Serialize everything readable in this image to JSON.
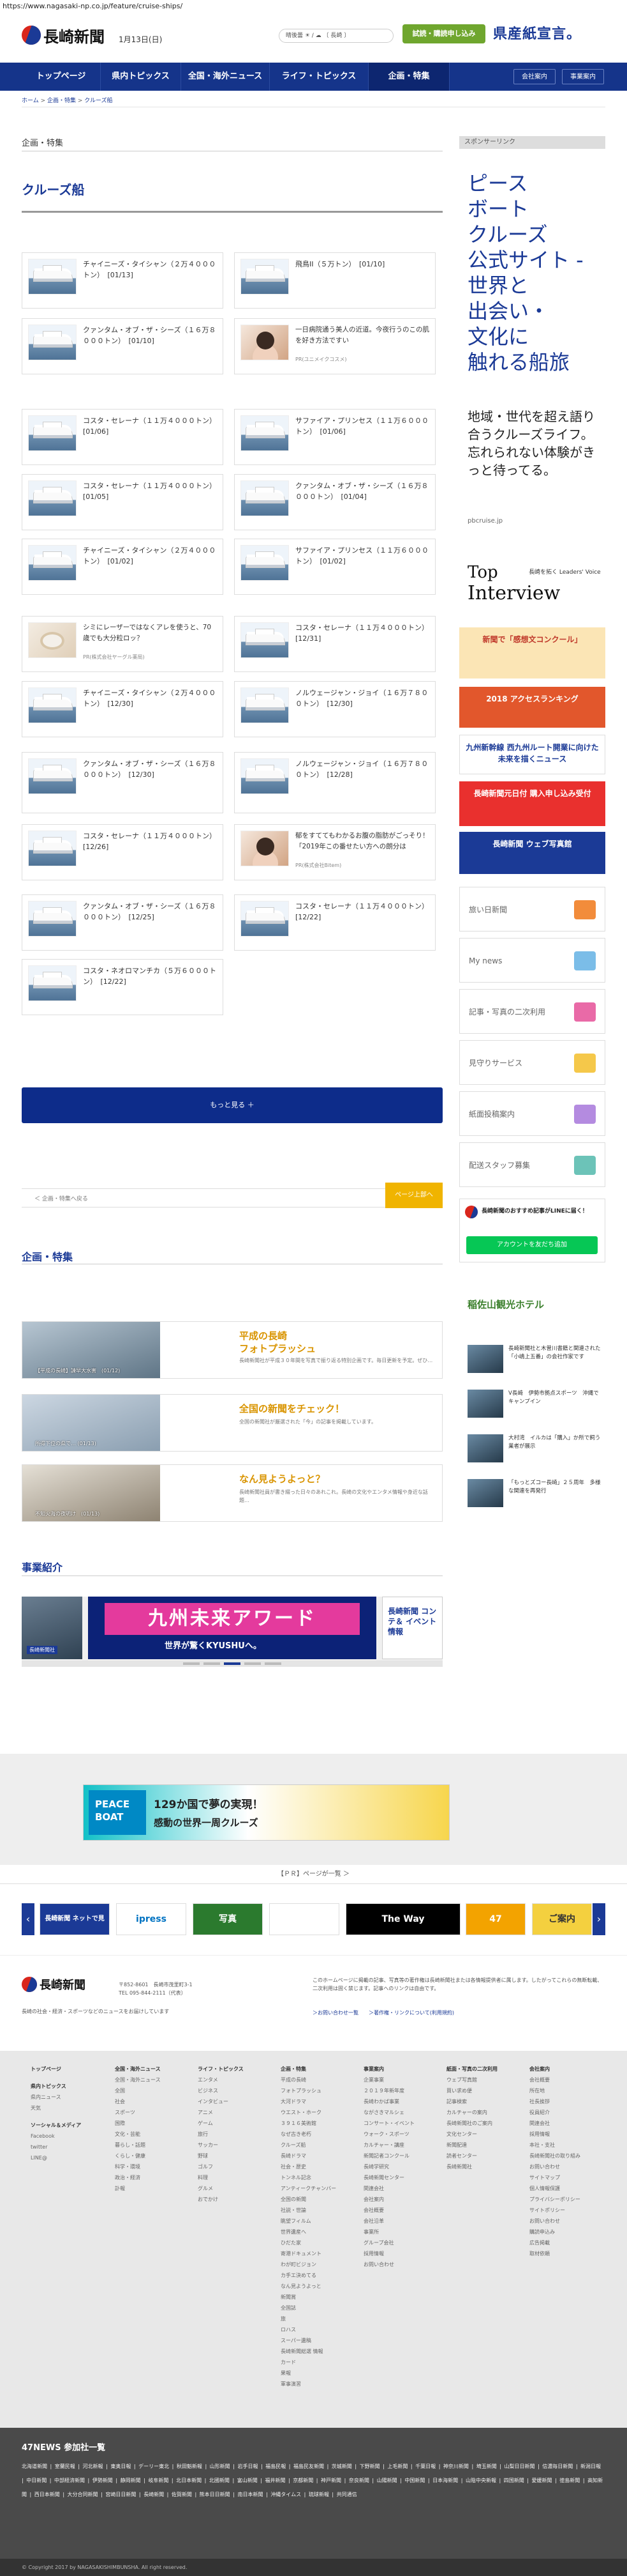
{
  "url": "https://www.nagasaki-np.co.jp/feature/cruise-ships/",
  "header": {
    "logo": "長崎新聞",
    "date": "1月13日(日)",
    "weather": "晴後曇 ☀ / ☁ 〔 長崎 〕",
    "trial_button": "試読・購読申し込み",
    "banner_text": "県産紙宣言。",
    "banner_accent": "紙"
  },
  "nav": {
    "items": [
      "トップページ",
      "県内トピックス",
      "全国・海外ニュース",
      "ライフ・トピックス",
      "企画・特集"
    ],
    "active_index": 4,
    "right": [
      "会社案内",
      "事業案内"
    ]
  },
  "breadcrumb": {
    "items": [
      "ホーム",
      "企画・特集",
      "クルーズ船"
    ],
    "separator": " > "
  },
  "section_label": "企画・特集",
  "page_title": "クルーズ船",
  "cards": [
    {
      "kind": "ship",
      "text": "チャイニーズ・タイシャン（２万４０００トン）　[01/13]"
    },
    {
      "kind": "ship",
      "text": "飛鳥II（５万トン）　[01/10]"
    },
    {
      "kind": "ship",
      "text": "クァンタム・オブ・ザ・シーズ（１６万８０００トン）　[01/10]"
    },
    {
      "kind": "person",
      "text": "一日病院通う美人の近道。今夜行うのこの肌を好き方法ですい",
      "sub": "PR(ユニメイクコスメ)"
    },
    {
      "kind": "ship",
      "text": "コスタ・セレーナ（１１万４０００トン）　[01/06]"
    },
    {
      "kind": "ship",
      "text": "サファイア・プリンセス（１１万６０００トン）　[01/06]"
    },
    {
      "kind": "ship",
      "text": "コスタ・セレーナ（１１万４０００トン）　[01/05]"
    },
    {
      "kind": "ship",
      "text": "クァンタム・オブ・ザ・シーズ（１６万８０００トン）　[01/04]"
    },
    {
      "kind": "ship",
      "text": "チャイニーズ・タイシャン（２万４０００トン）　[01/02]"
    },
    {
      "kind": "ship",
      "text": "サファイア・プリンセス（１１万６０００トン）　[01/02]"
    },
    {
      "kind": "ad",
      "text": "シミにレーザーではなくアレを使うと、70歳でも大分粒ロッ？",
      "sub": "PR(株式会社ヤーグル薬局)"
    },
    {
      "kind": "ship",
      "text": "コスタ・セレーナ（１１万４０００トン）　[12/31]"
    },
    {
      "kind": "ship",
      "text": "チャイニーズ・タイシャン（２万４０００トン）　[12/30]"
    },
    {
      "kind": "ship",
      "text": "ノルウェージャン・ジョイ（１６万７８００トン）　[12/30]"
    },
    {
      "kind": "ship",
      "text": "クァンタム・オブ・ザ・シーズ（１６万８０００トン）　[12/30]"
    },
    {
      "kind": "ship",
      "text": "ノルウェージャン・ジョイ（１６万７８００トン）　[12/28]"
    },
    {
      "kind": "ship",
      "text": "コスタ・セレーナ（１１万４０００トン）　[12/26]"
    },
    {
      "kind": "person",
      "text": "郁をすててもわかるお腹の脂肪がごっそり！「2019年この番せたい方への朗分は",
      "sub": "PR(株式会社Bitem)"
    },
    {
      "kind": "ship",
      "text": "クァンタム・オブ・ザ・シーズ（１６万８０００トン）　[12/25]"
    },
    {
      "kind": "ship",
      "text": "コスタ・セレーナ（１１万４０００トン）　[12/22]"
    },
    {
      "kind": "ship",
      "text": "コスタ・ネオロマンチカ（５万６０００トン）　[12/22]"
    }
  ],
  "more_button": "もっと見る ＋",
  "back": {
    "left": "＜ 企画・特集へ戻る",
    "right": "ページ上部へ"
  },
  "feature_heading": "企画・特集",
  "features": [
    {
      "title_line1": "平成の長崎",
      "title_line2": "フォトプラッシュ",
      "desc": "長崎新聞社が平成３０年間を写真で振り返る特別企画です。毎日更新を予定。ぜひ…",
      "caption": "【平成の長崎】諫早大水害　(01/12)"
    },
    {
      "title_line1": "全国の新聞をチェック！",
      "title_line2": "",
      "desc": "全国の新聞社が厳選された「今」の記事を掲載しています。",
      "caption": "所得下位の県で… (01/13)"
    },
    {
      "title_line1": "なん見ようよっと？",
      "title_line2": "",
      "desc": "長崎新聞社員が書き綴った日々のあれこれ。長崎の文化やエンタメ情報や身近な話題…",
      "caption": "不知火海の夜明け　(01/13)"
    }
  ],
  "business_heading": "事業紹介",
  "business_slider": {
    "left_caption": "長崎新聞社",
    "main_title": "九州未来アワード",
    "main_sub": "世界が驚くKYUSHUへ。",
    "right_title": "長崎新聞 コンテ＆ イベント情報"
  },
  "peace_boat": {
    "logo": "PEACE BOAT",
    "line1": "129か国で夢の実現！",
    "line2": "感動の世界一周クルーズ"
  },
  "pr_heading": "【ＰＲ】ページが一覧 ＞",
  "logos_row": [
    "長崎新聞 ネットで見",
    "ipress",
    "写真",
    "",
    "The Way",
    "47",
    "ご案内"
  ],
  "footer": {
    "logo": "長崎新聞",
    "address": "〒852-8601　長崎市茂里町3-1",
    "tel": "TEL 095-844-2111（代表）",
    "desc": "長崎の社会・経済・スポーツなどのニュースをお届けしています",
    "note": "このホームページに掲載の記事、写真等の著作権は長崎新聞社または各情報提供者に属します。したがってこれらの無断転載、二次利用は固く禁じます。記事へのリンクは自由です。",
    "links": "＞お問い合わせ一覧　　＞著作権・リンクについて(利用規約)"
  },
  "sitemap": [
    {
      "head": "トップページ",
      "items": [],
      "sub": [
        {
          "head": "県内トピックス",
          "items": [
            "県内ニュース",
            "天気"
          ]
        },
        {
          "head": "ソーシャル＆メディア",
          "items": [
            "Facebook",
            "twitter",
            "LINE@"
          ]
        }
      ]
    },
    {
      "head": "全国・海外ニュース",
      "items": [
        "全国・海外ニュース",
        "全国",
        "社会",
        "スポーツ",
        "国際",
        "文化・芸能",
        "暮らし・話題",
        "くらし・健康",
        "科学・環境",
        "政治・経済",
        "訃報"
      ]
    },
    {
      "head": "ライフ・トピックス",
      "items": [
        "エンタメ",
        "ビジネス",
        "インタビュー",
        "アニメ",
        "ゲーム",
        "旅行",
        "サッカー",
        "野球",
        "ゴルフ",
        "料理",
        "グルメ",
        "おでかけ"
      ]
    },
    {
      "head": "企画・特集",
      "items": [
        "平成の長崎",
        "フォトプラッシュ",
        "大河ドラマ",
        "ウエスト・ホーク",
        "３９１６美術館",
        "なぜ古き老朽",
        "クルーズ船",
        "長崎ドラマ",
        "社会・歴史",
        "トンネル記念",
        "アンティークチャンバー",
        "全国の新聞",
        "社説・世論",
        "眺望フィルム",
        "世界遺産へ",
        "ひだた家",
        "寄港ドキュメント",
        "わが町ビジョン",
        "カ手エ決めてる",
        "なん見ようよっと",
        "新聞賞",
        "全国誌",
        "旅",
        "ロハス",
        "スーパー遺稿",
        "長崎新聞総選 情報",
        "カード",
        "果報",
        "軍事演習"
      ]
    },
    {
      "head": "事業案内",
      "items": [
        "企業事業",
        "２０１９年新年度",
        "長崎わかば事業",
        "ながさきマルシェ",
        "コンサート・イベント",
        "ウォーク・スポーツ",
        "カルチャー・講座",
        "新聞記者コンクール",
        "長崎学研究",
        "長崎新聞センター",
        "関連会社",
        "会社案内",
        "会社概要",
        "会社沿革",
        "事業所",
        "グループ会社",
        "採用情報",
        "お問い合わせ"
      ]
    },
    {
      "head": "紙面・写真の二次利用",
      "items": [
        "ウェブ写真館",
        "買い求め便",
        "記事検索",
        "カルチャーの案内",
        "長崎新聞社のご案内",
        "文化センター",
        "新聞配達",
        "読者センター",
        "長崎新聞社"
      ]
    },
    {
      "head": "会社案内",
      "items": [
        "会社概要",
        "所在地",
        "社長挨拶",
        "役員紹介",
        "関連会社",
        "採用情報",
        "本社・支社",
        "長崎新聞社の取り組み",
        "お問い合わせ",
        "サイトマップ",
        "個人情報保護",
        "プライバシーポリシー",
        "サイトポリシー",
        "お問い合わせ",
        "購読申込み",
        "広告掲載",
        "取材依頼"
      ]
    }
  ],
  "news47": {
    "heading": "47NEWS 参加社一覧",
    "list": "北海道新聞 | 室蘭民報 | 河北新報 | 東奥日報 | デーリー東北 | 秋田魁新報 | 山形新聞 | 岩手日報 | 福島民報 | 福島民友新聞 | 茨城新聞 | 下野新聞 | 上毛新聞 | 千葉日報 | 神奈川新聞 | 埼玉新聞 | 山梨日日新聞 | 信濃毎日新聞 | 新潟日報 | 中日新聞 | 中部経済新聞 | 伊勢新聞 | 静岡新聞 | 岐阜新聞 | 北日本新聞 | 北國新聞 | 富山新聞 | 福井新聞 | 京都新聞 | 神戸新聞 | 奈良新聞 | 山陽新聞 | 中国新聞 | 日本海新聞 | 山陰中央新報 | 四国新聞 | 愛媛新聞 | 徳島新聞 | 高知新聞 | 西日本新聞 | 大分合同新聞 | 宮崎日日新聞 | 長崎新聞 | 佐賀新聞 | 熊本日日新聞 | 南日本新聞 | 沖縄タイムス | 琉球新報 | 共同通信"
  },
  "copyright": "© Copyright 2017 by NAGASAKISHIMBUNSHA. All right reserved.",
  "sidebar": {
    "sponsor_label": "スポンサーリンク",
    "ad_lines": [
      "ピース",
      "ボート",
      "クルーズ",
      "公式サイト -",
      "世界と",
      "出会い・",
      "文化に",
      "触れる船旅"
    ],
    "ad_sub": "地域・世代を超え語り合うクルーズライフ。忘れられない体験がきっと待ってる。",
    "ad_url": "pbcruise.jp",
    "interview": {
      "top": "Top",
      "label": "長崎を拓く Leaders' Voice",
      "bottom": "Interview"
    },
    "banners": [
      {
        "text": "新聞で「感想文コンクール」",
        "bg": "#fbe5b5",
        "fg": "#c0392b"
      },
      {
        "text": "2018 アクセスランキング",
        "bg": "#e2572c",
        "fg": "#ffffff"
      },
      {
        "text": "九州新幹線 西九州ルート開業に向けた未来を描くニュース",
        "bg": "#ffffff",
        "fg": "#1b3a96"
      },
      {
        "text": "長崎新聞元日付 購入申し込み受付",
        "bg": "#e9302e",
        "fg": "#ffffff"
      },
      {
        "text": "長崎新聞 ウェブ写真館",
        "bg": "#1b3a96",
        "fg": "#ffffff"
      }
    ],
    "buttons": [
      {
        "label": "旅い日新聞",
        "color": "#f28c3b"
      },
      {
        "label": "My news",
        "color": "#7bbde8"
      },
      {
        "label": "記事・写真の二次利用",
        "color": "#e96aa7"
      },
      {
        "label": "見守りサービス",
        "color": "#f5c84a"
      },
      {
        "label": "紙面投稿案内",
        "color": "#b48be0"
      },
      {
        "label": "配送スタッフ募集",
        "color": "#6cc3b8"
      }
    ],
    "line": {
      "title": "長崎新聞のおすすめ記事がLINEに届く！",
      "button": "アカウントを友だち追加"
    },
    "hotel": "稲佐山観光ホテル",
    "news": [
      {
        "text": "長崎新聞社と木曽川書籍と関連された「小嶋上五番」の会社作家です"
      },
      {
        "text": "V長崎　伊勢市拠点スポーツ　沖縄でキャンプイン"
      },
      {
        "text": "大村湾　イルカは「購入」か所で飼う　業者が展示"
      },
      {
        "text": "「もっとズコー長崎」２５周年　多様な関連を再発行"
      }
    ]
  }
}
